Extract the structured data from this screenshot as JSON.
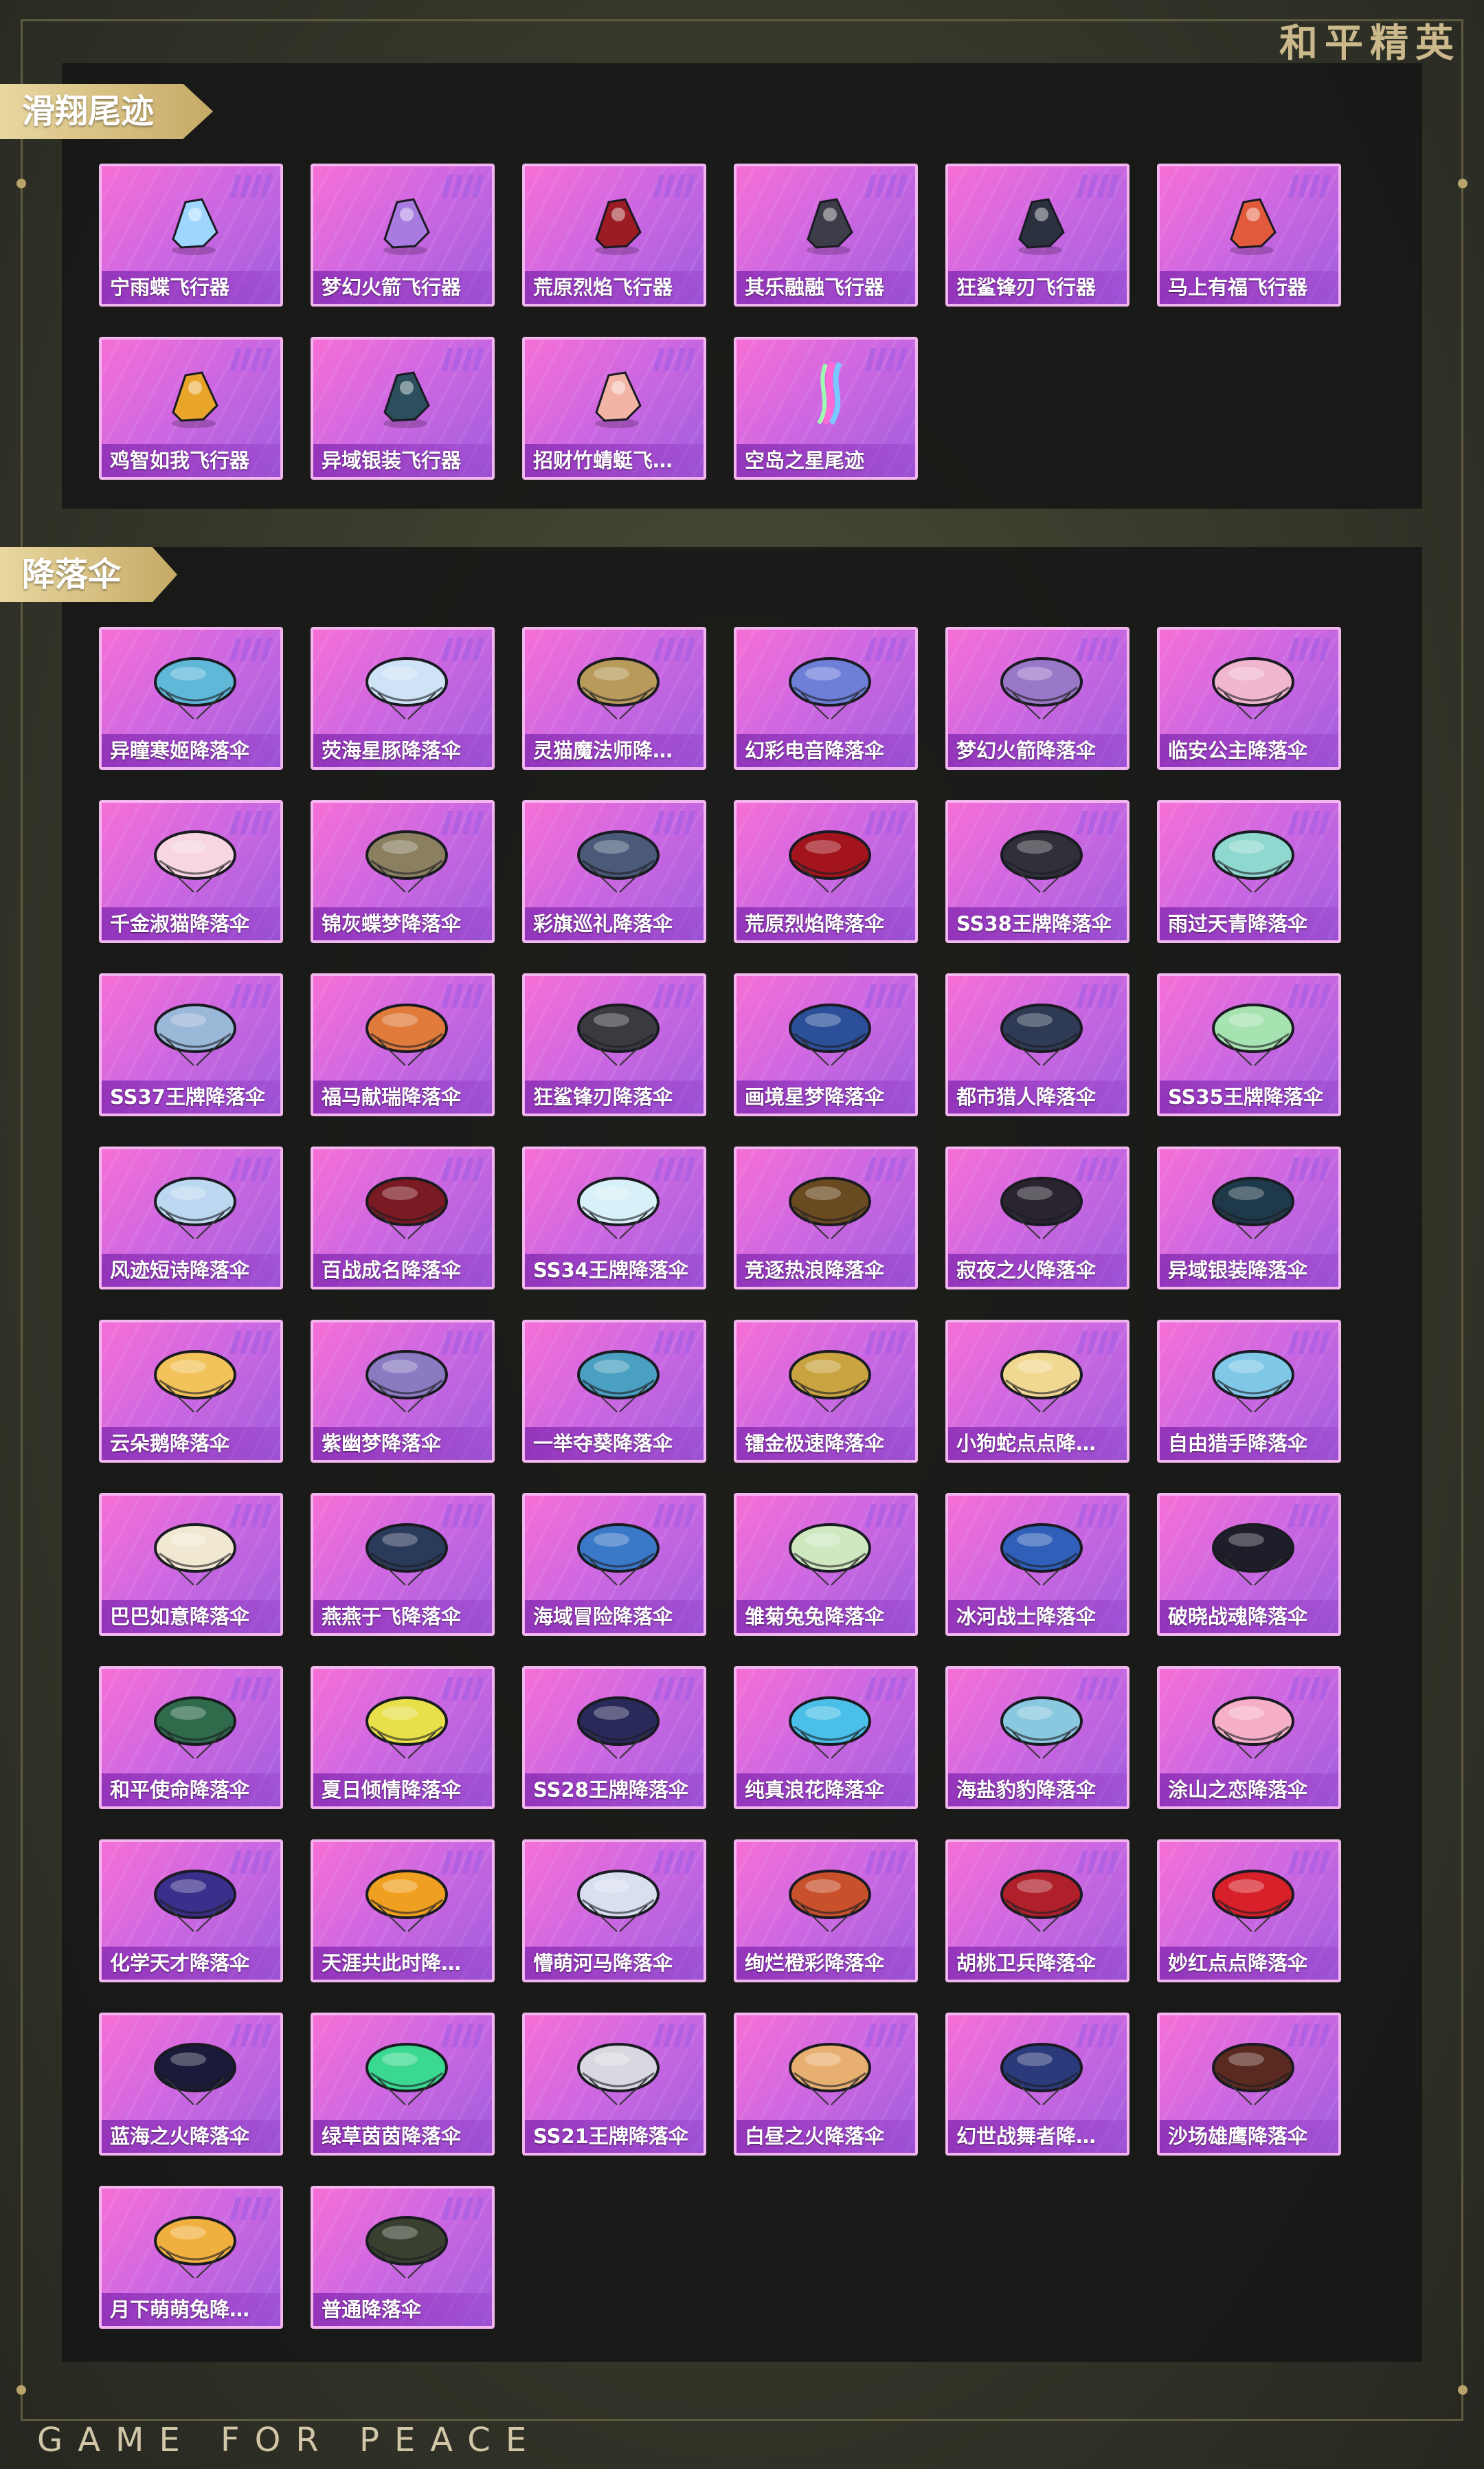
{
  "brand": {
    "top_logo": "和平精英",
    "bottom_logo": "GAME FOR PEACE"
  },
  "sections": [
    {
      "title": "滑翔尾迹",
      "items": [
        {
          "label": "宁雨蝶飞行器",
          "icon": "butterfly-glider-icon",
          "color": "#9fd6ff"
        },
        {
          "label": "梦幻火箭飞行器",
          "icon": "rocket-glider-icon",
          "color": "#a77be0"
        },
        {
          "label": "荒原烈焰飞行器",
          "icon": "flame-glider-icon",
          "color": "#9b1c22"
        },
        {
          "label": "其乐融融飞行器",
          "icon": "penguin-glider-icon",
          "color": "#3d3d4a"
        },
        {
          "label": "狂鲨锋刃飞行器",
          "icon": "shark-glider-icon",
          "color": "#2c3140"
        },
        {
          "label": "马上有福飞行器",
          "icon": "horse-glider-icon",
          "color": "#e25a3c"
        },
        {
          "label": "鸡智如我飞行器",
          "icon": "chicken-glider-icon",
          "color": "#e8a52a"
        },
        {
          "label": "异域银装飞行器",
          "icon": "dragon-glider-icon",
          "color": "#2b4f5c"
        },
        {
          "label": "招财竹蜻蜓飞…",
          "icon": "bamboo-copter-icon",
          "color": "#f2b4a5"
        },
        {
          "label": "空岛之星尾迹",
          "icon": "rainbow-trail-icon",
          "color": "#b98af0"
        }
      ]
    },
    {
      "title": "降落伞",
      "items": [
        {
          "label": "异瞳寒姬降落伞",
          "icon": "parachute-icon",
          "color": "#5fb8d8"
        },
        {
          "label": "荧海星豚降落伞",
          "icon": "parachute-icon",
          "color": "#cfe3f7"
        },
        {
          "label": "灵猫魔法师降…",
          "icon": "parachute-icon",
          "color": "#b89a5a"
        },
        {
          "label": "幻彩电音降落伞",
          "icon": "parachute-icon",
          "color": "#6e7fd8"
        },
        {
          "label": "梦幻火箭降落伞",
          "icon": "parachute-icon",
          "color": "#9a78c8"
        },
        {
          "label": "临安公主降落伞",
          "icon": "parachute-icon",
          "color": "#f0b7cf"
        },
        {
          "label": "千金淑猫降落伞",
          "icon": "parachute-icon",
          "color": "#f7d6e2"
        },
        {
          "label": "锦灰蝶梦降落伞",
          "icon": "parachute-icon",
          "color": "#8a8060"
        },
        {
          "label": "彩旗巡礼降落伞",
          "icon": "parachute-icon",
          "color": "#4a5a78"
        },
        {
          "label": "荒原烈焰降落伞",
          "icon": "parachute-icon",
          "color": "#a3141c"
        },
        {
          "label": "SS38王牌降落伞",
          "icon": "parachute-icon",
          "color": "#30303a"
        },
        {
          "label": "雨过天青降落伞",
          "icon": "parachute-icon",
          "color": "#8fd8cf"
        },
        {
          "label": "SS37王牌降落伞",
          "icon": "parachute-icon",
          "color": "#9ab8d8"
        },
        {
          "label": "福马献瑞降落伞",
          "icon": "parachute-icon",
          "color": "#e07b3c"
        },
        {
          "label": "狂鲨锋刃降落伞",
          "icon": "parachute-icon",
          "color": "#3a3a40"
        },
        {
          "label": "画境星梦降落伞",
          "icon": "parachute-icon",
          "color": "#2c4f9a"
        },
        {
          "label": "都市猎人降落伞",
          "icon": "parachute-icon",
          "color": "#2f3a55"
        },
        {
          "label": "SS35王牌降落伞",
          "icon": "parachute-icon",
          "color": "#a7e3b0"
        },
        {
          "label": "风迹短诗降落伞",
          "icon": "parachute-icon",
          "color": "#bcd8f0"
        },
        {
          "label": "百战成名降落伞",
          "icon": "parachute-icon",
          "color": "#7a1a22"
        },
        {
          "label": "SS34王牌降落伞",
          "icon": "parachute-icon",
          "color": "#d8f0f7"
        },
        {
          "label": "竞逐热浪降落伞",
          "icon": "parachute-icon",
          "color": "#6a4a20"
        },
        {
          "label": "寂夜之火降落伞",
          "icon": "parachute-icon",
          "color": "#2a2430"
        },
        {
          "label": "异域银装降落伞",
          "icon": "parachute-icon",
          "color": "#1e3a4a"
        },
        {
          "label": "云朵鹅降落伞",
          "icon": "parachute-icon",
          "color": "#f2c35a"
        },
        {
          "label": "紫幽梦降落伞",
          "icon": "parachute-icon",
          "color": "#8a7ac0"
        },
        {
          "label": "一举夺葵降落伞",
          "icon": "parachute-icon",
          "color": "#4aa0c0"
        },
        {
          "label": "镭金极速降落伞",
          "icon": "parachute-icon",
          "color": "#c9a440"
        },
        {
          "label": "小狗蛇点点降…",
          "icon": "parachute-icon",
          "color": "#f0d890"
        },
        {
          "label": "自由猎手降落伞",
          "icon": "parachute-icon",
          "color": "#7fc8e8"
        },
        {
          "label": "巴巴如意降落伞",
          "icon": "parachute-icon",
          "color": "#f0e8d0"
        },
        {
          "label": "燕燕于飞降落伞",
          "icon": "parachute-icon",
          "color": "#2a3a5a"
        },
        {
          "label": "海域冒险降落伞",
          "icon": "parachute-icon",
          "color": "#3a78c8"
        },
        {
          "label": "雏菊兔兔降落伞",
          "icon": "parachute-icon",
          "color": "#cfe8c0"
        },
        {
          "label": "冰河战士降落伞",
          "icon": "parachute-icon",
          "color": "#2f5fb8"
        },
        {
          "label": "破晓战魂降落伞",
          "icon": "parachute-icon",
          "color": "#1e1e2a"
        },
        {
          "label": "和平使命降落伞",
          "icon": "parachute-icon",
          "color": "#2f6a4a"
        },
        {
          "label": "夏日倾情降落伞",
          "icon": "parachute-icon",
          "color": "#e8e04a"
        },
        {
          "label": "SS28王牌降落伞",
          "icon": "parachute-icon",
          "color": "#2a2a5a"
        },
        {
          "label": "纯真浪花降落伞",
          "icon": "parachute-icon",
          "color": "#4ac0e8"
        },
        {
          "label": "海盐豹豹降落伞",
          "icon": "parachute-icon",
          "color": "#8ac8e0"
        },
        {
          "label": "涂山之恋降落伞",
          "icon": "parachute-icon",
          "color": "#f5b0c8"
        },
        {
          "label": "化学天才降落伞",
          "icon": "parachute-icon",
          "color": "#3a2f8a"
        },
        {
          "label": "天涯共此时降…",
          "icon": "parachute-icon",
          "color": "#f0a020"
        },
        {
          "label": "懵萌河马降落伞",
          "icon": "parachute-icon",
          "color": "#d8e0f0"
        },
        {
          "label": "绚烂橙彩降落伞",
          "icon": "parachute-icon",
          "color": "#c8502a"
        },
        {
          "label": "胡桃卫兵降落伞",
          "icon": "parachute-icon",
          "color": "#b0202a"
        },
        {
          "label": "妙红点点降落伞",
          "icon": "parachute-icon",
          "color": "#d8202a"
        },
        {
          "label": "蓝海之火降落伞",
          "icon": "parachute-icon",
          "color": "#1a1a3a"
        },
        {
          "label": "绿草茵茵降落伞",
          "icon": "parachute-icon",
          "color": "#3ad890"
        },
        {
          "label": "SS21王牌降落伞",
          "icon": "parachute-icon",
          "color": "#d8d8e0"
        },
        {
          "label": "白昼之火降落伞",
          "icon": "parachute-icon",
          "color": "#e8b070"
        },
        {
          "label": "幻世战舞者降…",
          "icon": "parachute-icon",
          "color": "#2a3a7a"
        },
        {
          "label": "沙场雄鹰降落伞",
          "icon": "parachute-icon",
          "color": "#5a2a20"
        },
        {
          "label": "月下萌萌兔降…",
          "icon": "parachute-icon",
          "color": "#f0b040"
        },
        {
          "label": "普通降落伞",
          "icon": "parachute-icon",
          "color": "#3a4030"
        }
      ]
    }
  ]
}
